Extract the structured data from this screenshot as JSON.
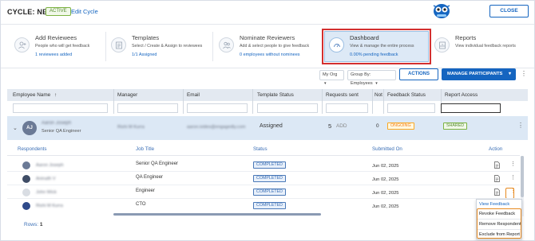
{
  "header": {
    "cycle_title": "CYCLE: NEW",
    "status_badge": "ACTIVE",
    "edit_link": "Edit Cycle",
    "close_button": "CLOSE"
  },
  "steps": [
    {
      "title": "Add Reviewees",
      "desc": "People who will get feedback",
      "stat": "1 reviewees added",
      "icon": "add-user-icon"
    },
    {
      "title": "Templates",
      "desc": "Select / Create & Assign to reviewees",
      "stat": "1/1  Assigned",
      "icon": "template-icon"
    },
    {
      "title": "Nominate Reviewers",
      "desc": "Add & select people to give feedback",
      "stat": "0  employees without nominees",
      "icon": "users-icon"
    },
    {
      "title": "Dashboard",
      "desc": "View & manage the entire process",
      "stat": "0.00% pending feedback",
      "icon": "dashboard-icon"
    },
    {
      "title": "Reports",
      "desc": "View individual feedback reports",
      "stat": "",
      "icon": "report-icon"
    }
  ],
  "toolbar": {
    "org_filter": "My Org",
    "group_by": "Group By: Employees",
    "actions_button": "ACTIONS",
    "manage_button": "MANAGE PARTICIPANTS"
  },
  "table": {
    "columns": [
      "Employee Name",
      "Manager",
      "Email",
      "Template Status",
      "Requests sent",
      "Not",
      "Feedback Status",
      "Report Access"
    ],
    "row": {
      "initials": "AJ",
      "name": "Aaron Joseph",
      "role": "Senior QA Engineer",
      "manager": "Rishi M Kurra",
      "email": "aaron.ivides@engagedly.com",
      "template_status": "Assigned",
      "requests_sent": "5",
      "add_label": "ADD",
      "not_value": "0",
      "feedback_status": "ONGOING",
      "report_access": "SHARED"
    }
  },
  "subtable": {
    "columns": [
      "Respondents",
      "Job Title",
      "Status",
      "Submitted On",
      "Action"
    ],
    "rows": [
      {
        "name": "Aaron Joseph",
        "job": "Senior QA Engineer",
        "status": "COMPLETED",
        "date": "Jun 02, 2025",
        "avatar_color": "#6b7a96"
      },
      {
        "name": "Anirudh V",
        "job": "QA Engineer",
        "status": "COMPLETED",
        "date": "Jun 02, 2025",
        "avatar_color": "#3f4d66"
      },
      {
        "name": "John Wick",
        "job": "Engineer",
        "status": "COMPLETED",
        "date": "Jun 02, 2025",
        "avatar_color": "#d9dde3"
      },
      {
        "name": "Rishi M Kurra",
        "job": "CTO",
        "status": "COMPLETED",
        "date": "Jun 02, 2025",
        "avatar_color": "#2f4a8a"
      }
    ]
  },
  "footer": {
    "rows_label": "Rows:",
    "rows_count": "1"
  },
  "menu": {
    "items": [
      "View Feedback",
      "Revoke Feedback",
      "Remove Respondent",
      "Exclude from Report"
    ]
  },
  "colors": {
    "primary": "#1565c0",
    "highlight_red": "#d32f2f",
    "highlight_orange": "#e6891f"
  }
}
